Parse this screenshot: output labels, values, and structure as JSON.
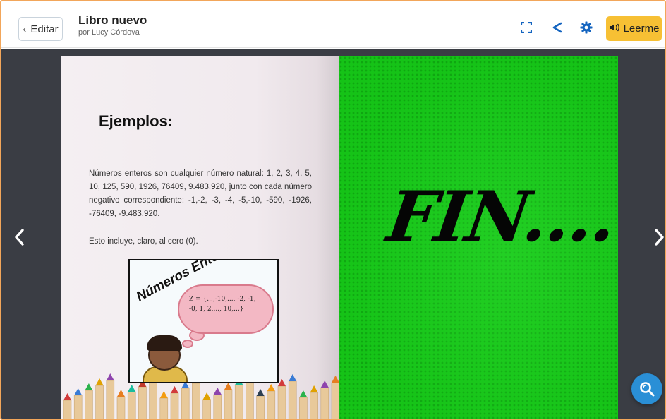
{
  "header": {
    "back_label": "Editar",
    "title": "Libro nuevo",
    "author": "por Lucy Córdova",
    "read_label": "Leerme",
    "icons": [
      "fullscreen-icon",
      "share-icon",
      "settings-icon",
      "speaker-icon"
    ]
  },
  "navigation": {
    "prev_icon": "chevron-left-icon",
    "next_icon": "chevron-right-icon"
  },
  "book": {
    "left_page": {
      "heading": "Ejemplos:",
      "paragraph": "Números enteros son cualquier número natural: 1, 2, 3, 4, 5, 10, 125, 590, 1926, 76409, 9.483.920, junto con cada número negativo correspondiente: -1,-2, -3, -4, -5,-10, -590, -1926, -76409, -9.483.920.",
      "paragraph2": "Esto incluye, claro, al cero (0).",
      "illustration": {
        "title": "Números Enteros",
        "cloud_line1": "Z = {...,-10,..., -2, -1,",
        "cloud_line2": "-0, 1, 2,..., 10,...}"
      }
    },
    "right_page": {
      "text": "FIN....",
      "background": "#15c317"
    }
  },
  "colors": {
    "accent": "#f7c034",
    "icon_blue": "#1565c0",
    "zoom_button": "#2a8fd6",
    "stage": "#3a3d44"
  },
  "zoom_icon": "search-icon"
}
